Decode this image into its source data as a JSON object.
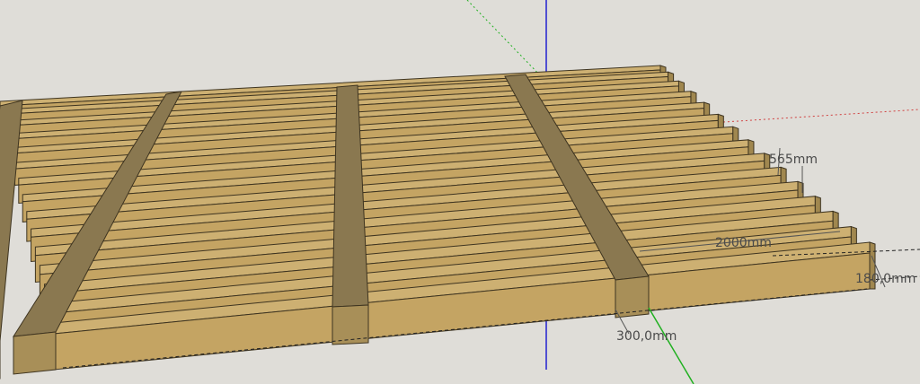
{
  "app": "3D modeling viewport",
  "colors": {
    "background": "#dfddd8",
    "slat_top": "#cdb072",
    "slat_face": "#c4a463",
    "slat_edge": "#3e3420",
    "beam_top": "#8a7850",
    "beam_face": "#a88f58",
    "axis_red": "#d04040",
    "axis_green": "#20b020",
    "axis_blue": "#2020d0"
  },
  "dimensions": {
    "spacing": "565mm",
    "length": "2000mm",
    "height": "180,0mm",
    "width": "300,0mm"
  },
  "model": {
    "slat_count": 15,
    "beam_count": 4
  }
}
